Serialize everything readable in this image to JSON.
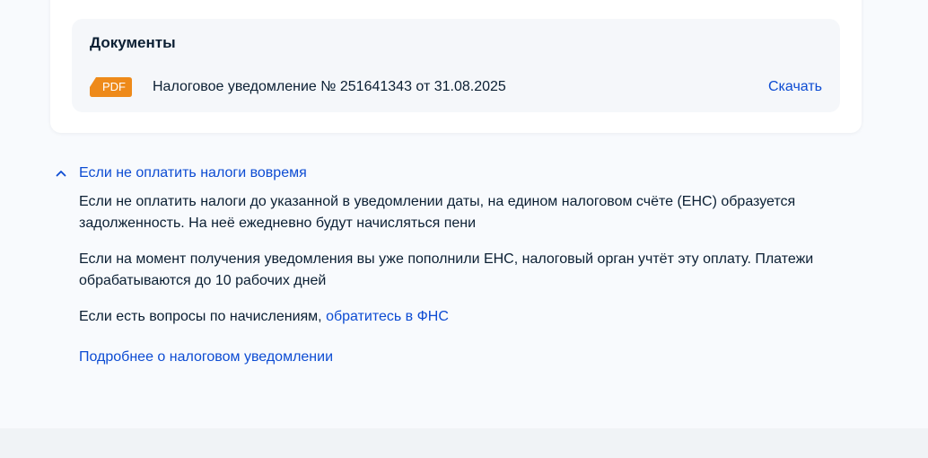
{
  "documents": {
    "title": "Документы",
    "items": [
      {
        "type_label": "PDF",
        "name": "Налоговое уведомление № 251641343 от 31.08.2025",
        "action_label": "Скачать"
      }
    ]
  },
  "accordion": {
    "title": "Если не оплатить налоги вовремя",
    "expanded": true,
    "paragraph1": "Если не оплатить налоги до указанной в уведомлении даты, на едином налоговом счёте (ЕНС) образуется задолженность. На неё ежедневно будут начисляться пени",
    "paragraph2": "Если на момент получения уведомления вы уже пополнили ЕНС, налоговый орган учтёт эту оплату. Платежи обрабатываются до 10 рабочих дней",
    "paragraph3_text": "Если есть вопросы по начислениям, ",
    "paragraph3_link": "обратитесь в ФНС"
  },
  "more_link": "Подробнее о налоговом уведомлении",
  "colors": {
    "accent": "#0d4cd3",
    "pdf_badge": "#ee8a1a",
    "text": "#0b1f33",
    "page_bg": "#f8fafd",
    "card_bg": "#ffffff",
    "docs_bg": "#f5f7fa"
  },
  "icons": {
    "pdf": "pdf-file-icon",
    "chevron": "chevron-up-icon"
  }
}
